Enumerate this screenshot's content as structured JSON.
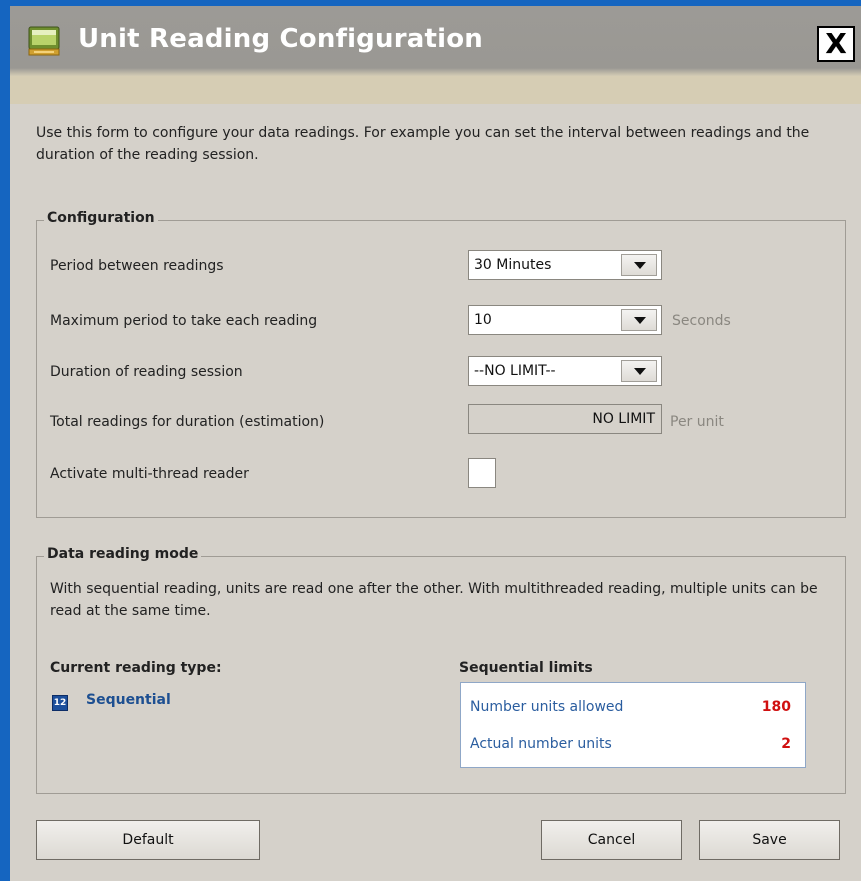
{
  "window": {
    "title": "Unit Reading Configuration",
    "close_label": "X"
  },
  "intro": "Use this form to configure your data readings. For example you can set the interval between readings and the duration of the reading session.",
  "configuration": {
    "legend": "Configuration",
    "period_label": "Period between readings",
    "period_value": "30 Minutes",
    "max_period_label": "Maximum period to take each reading",
    "max_period_value": "10",
    "max_period_unit": "Seconds",
    "duration_label": "Duration of reading session",
    "duration_value": "--NO LIMIT--",
    "total_label": "Total readings for duration (estimation)",
    "total_value": "NO LIMIT",
    "total_unit": "Per unit",
    "multithread_label": "Activate multi-thread reader",
    "multithread_checked": false
  },
  "mode": {
    "legend": "Data reading mode",
    "description": "With sequential reading, units are read one after the other. With multithreaded reading, multiple units can be read at the same time.",
    "current_type_heading": "Current reading type:",
    "current_type_value": "Sequential",
    "limits_heading": "Sequential limits",
    "limits": [
      {
        "label": "Number units allowed",
        "value": "180"
      },
      {
        "label": "Actual number units",
        "value": "2"
      }
    ]
  },
  "buttons": {
    "default": "Default",
    "cancel": "Cancel",
    "save": "Save"
  },
  "colors": {
    "desktop": "#1565c0",
    "dialog": "#d5d1ca",
    "link_blue": "#1d4f91",
    "limit_red": "#d01010"
  }
}
